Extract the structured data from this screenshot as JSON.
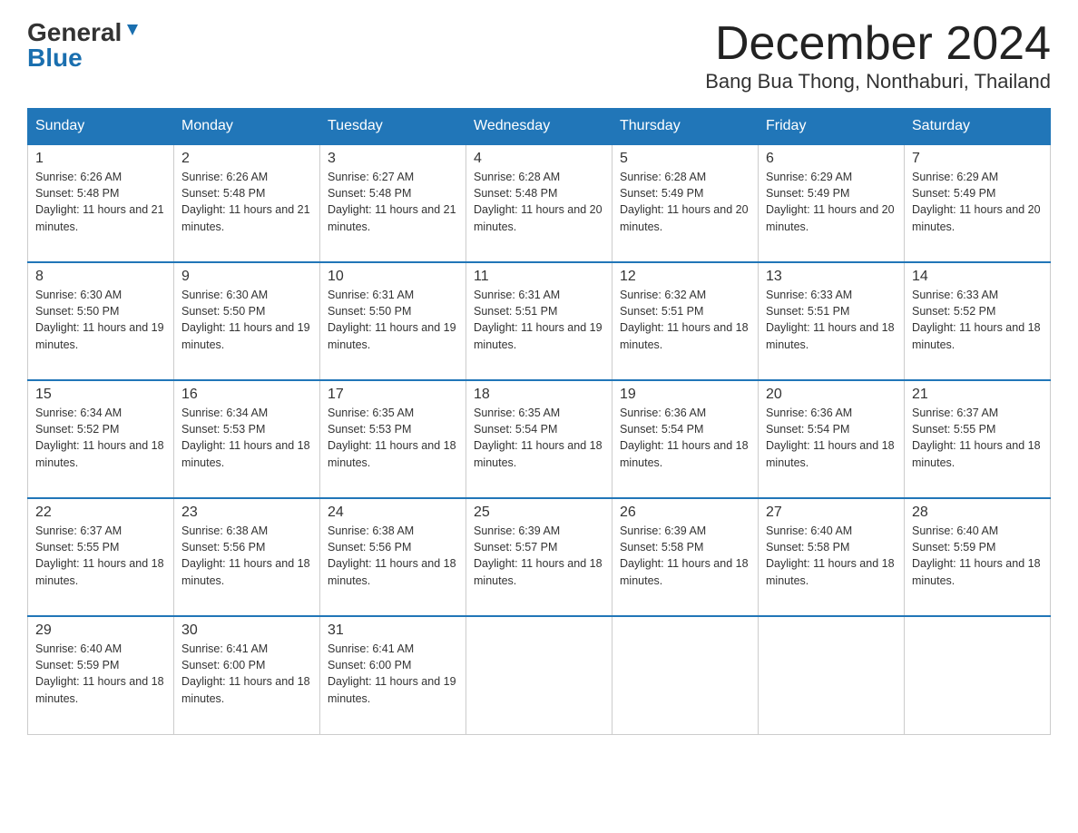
{
  "header": {
    "logo_general": "General",
    "logo_blue": "Blue",
    "month_title": "December 2024",
    "location": "Bang Bua Thong, Nonthaburi, Thailand"
  },
  "days_of_week": [
    "Sunday",
    "Monday",
    "Tuesday",
    "Wednesday",
    "Thursday",
    "Friday",
    "Saturday"
  ],
  "weeks": [
    [
      {
        "day": "1",
        "sunrise": "6:26 AM",
        "sunset": "5:48 PM",
        "daylight": "11 hours and 21 minutes."
      },
      {
        "day": "2",
        "sunrise": "6:26 AM",
        "sunset": "5:48 PM",
        "daylight": "11 hours and 21 minutes."
      },
      {
        "day": "3",
        "sunrise": "6:27 AM",
        "sunset": "5:48 PM",
        "daylight": "11 hours and 21 minutes."
      },
      {
        "day": "4",
        "sunrise": "6:28 AM",
        "sunset": "5:48 PM",
        "daylight": "11 hours and 20 minutes."
      },
      {
        "day": "5",
        "sunrise": "6:28 AM",
        "sunset": "5:49 PM",
        "daylight": "11 hours and 20 minutes."
      },
      {
        "day": "6",
        "sunrise": "6:29 AM",
        "sunset": "5:49 PM",
        "daylight": "11 hours and 20 minutes."
      },
      {
        "day": "7",
        "sunrise": "6:29 AM",
        "sunset": "5:49 PM",
        "daylight": "11 hours and 20 minutes."
      }
    ],
    [
      {
        "day": "8",
        "sunrise": "6:30 AM",
        "sunset": "5:50 PM",
        "daylight": "11 hours and 19 minutes."
      },
      {
        "day": "9",
        "sunrise": "6:30 AM",
        "sunset": "5:50 PM",
        "daylight": "11 hours and 19 minutes."
      },
      {
        "day": "10",
        "sunrise": "6:31 AM",
        "sunset": "5:50 PM",
        "daylight": "11 hours and 19 minutes."
      },
      {
        "day": "11",
        "sunrise": "6:31 AM",
        "sunset": "5:51 PM",
        "daylight": "11 hours and 19 minutes."
      },
      {
        "day": "12",
        "sunrise": "6:32 AM",
        "sunset": "5:51 PM",
        "daylight": "11 hours and 18 minutes."
      },
      {
        "day": "13",
        "sunrise": "6:33 AM",
        "sunset": "5:51 PM",
        "daylight": "11 hours and 18 minutes."
      },
      {
        "day": "14",
        "sunrise": "6:33 AM",
        "sunset": "5:52 PM",
        "daylight": "11 hours and 18 minutes."
      }
    ],
    [
      {
        "day": "15",
        "sunrise": "6:34 AM",
        "sunset": "5:52 PM",
        "daylight": "11 hours and 18 minutes."
      },
      {
        "day": "16",
        "sunrise": "6:34 AM",
        "sunset": "5:53 PM",
        "daylight": "11 hours and 18 minutes."
      },
      {
        "day": "17",
        "sunrise": "6:35 AM",
        "sunset": "5:53 PM",
        "daylight": "11 hours and 18 minutes."
      },
      {
        "day": "18",
        "sunrise": "6:35 AM",
        "sunset": "5:54 PM",
        "daylight": "11 hours and 18 minutes."
      },
      {
        "day": "19",
        "sunrise": "6:36 AM",
        "sunset": "5:54 PM",
        "daylight": "11 hours and 18 minutes."
      },
      {
        "day": "20",
        "sunrise": "6:36 AM",
        "sunset": "5:54 PM",
        "daylight": "11 hours and 18 minutes."
      },
      {
        "day": "21",
        "sunrise": "6:37 AM",
        "sunset": "5:55 PM",
        "daylight": "11 hours and 18 minutes."
      }
    ],
    [
      {
        "day": "22",
        "sunrise": "6:37 AM",
        "sunset": "5:55 PM",
        "daylight": "11 hours and 18 minutes."
      },
      {
        "day": "23",
        "sunrise": "6:38 AM",
        "sunset": "5:56 PM",
        "daylight": "11 hours and 18 minutes."
      },
      {
        "day": "24",
        "sunrise": "6:38 AM",
        "sunset": "5:56 PM",
        "daylight": "11 hours and 18 minutes."
      },
      {
        "day": "25",
        "sunrise": "6:39 AM",
        "sunset": "5:57 PM",
        "daylight": "11 hours and 18 minutes."
      },
      {
        "day": "26",
        "sunrise": "6:39 AM",
        "sunset": "5:58 PM",
        "daylight": "11 hours and 18 minutes."
      },
      {
        "day": "27",
        "sunrise": "6:40 AM",
        "sunset": "5:58 PM",
        "daylight": "11 hours and 18 minutes."
      },
      {
        "day": "28",
        "sunrise": "6:40 AM",
        "sunset": "5:59 PM",
        "daylight": "11 hours and 18 minutes."
      }
    ],
    [
      {
        "day": "29",
        "sunrise": "6:40 AM",
        "sunset": "5:59 PM",
        "daylight": "11 hours and 18 minutes."
      },
      {
        "day": "30",
        "sunrise": "6:41 AM",
        "sunset": "6:00 PM",
        "daylight": "11 hours and 18 minutes."
      },
      {
        "day": "31",
        "sunrise": "6:41 AM",
        "sunset": "6:00 PM",
        "daylight": "11 hours and 19 minutes."
      },
      {
        "day": "",
        "sunrise": "",
        "sunset": "",
        "daylight": ""
      },
      {
        "day": "",
        "sunrise": "",
        "sunset": "",
        "daylight": ""
      },
      {
        "day": "",
        "sunrise": "",
        "sunset": "",
        "daylight": ""
      },
      {
        "day": "",
        "sunrise": "",
        "sunset": "",
        "daylight": ""
      }
    ]
  ]
}
